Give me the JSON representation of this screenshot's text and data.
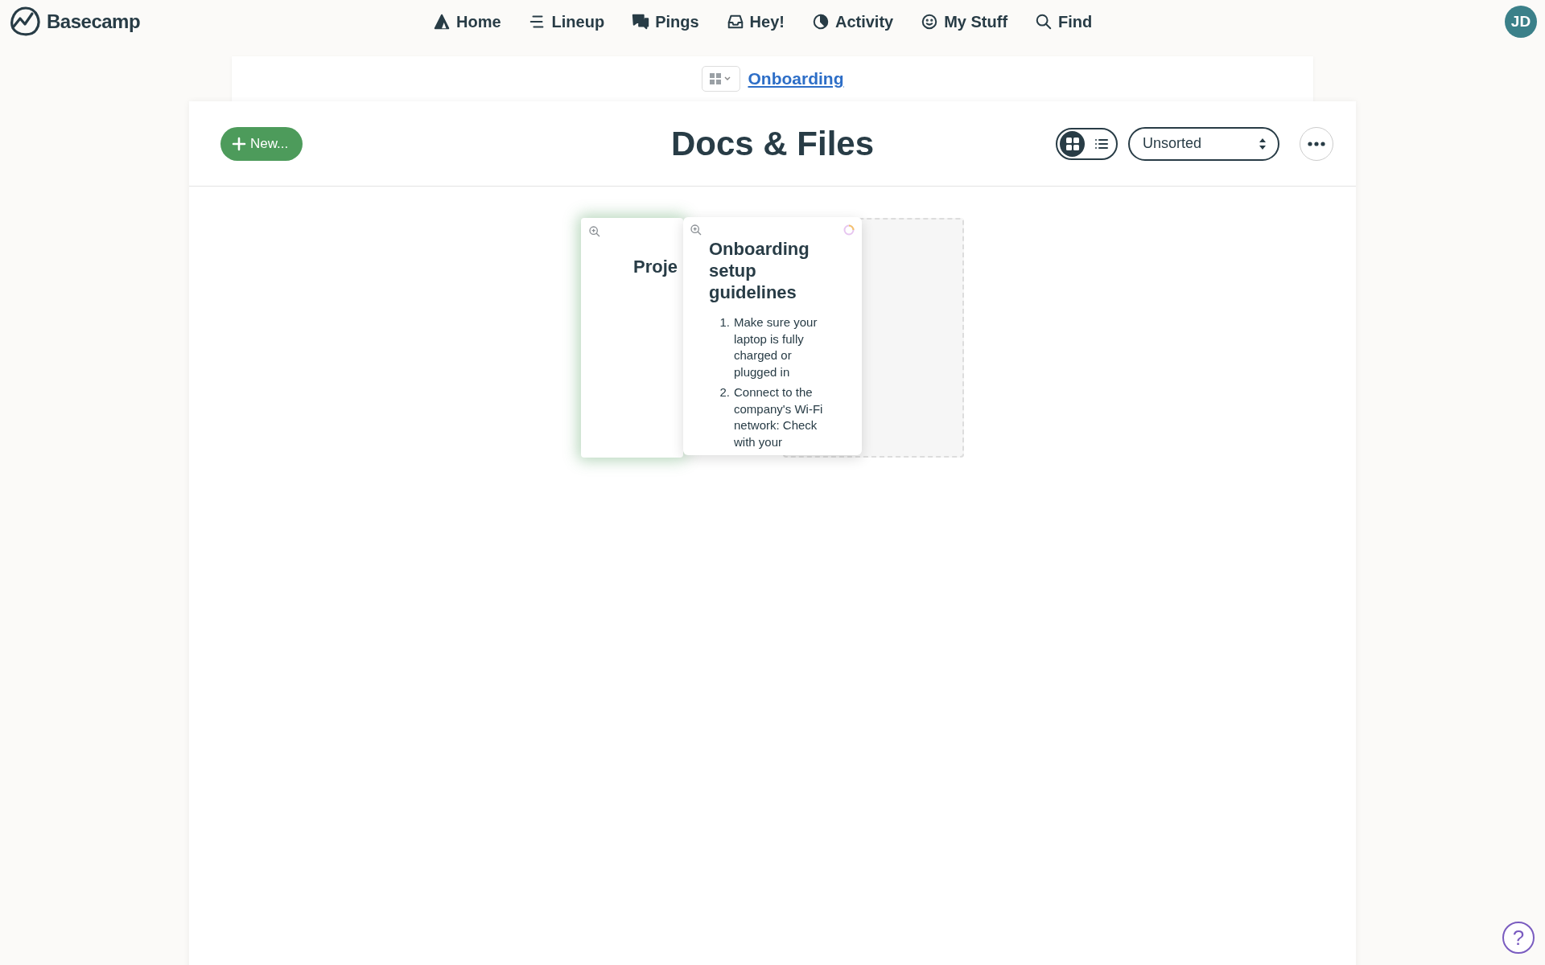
{
  "app": {
    "name": "Basecamp"
  },
  "nav": [
    {
      "label": "Home"
    },
    {
      "label": "Lineup"
    },
    {
      "label": "Pings"
    },
    {
      "label": "Hey!"
    },
    {
      "label": "Activity"
    },
    {
      "label": "My Stuff"
    },
    {
      "label": "Find"
    }
  ],
  "avatar": {
    "initials": "JD"
  },
  "breadcrumb": {
    "project": "Onboarding"
  },
  "toolbar": {
    "new_button": "New...",
    "title": "Docs & Files",
    "views": [
      {
        "kind": "grid",
        "selected": true
      },
      {
        "kind": "list",
        "selected": false
      }
    ],
    "sort": "Unsorted"
  },
  "cards": [
    {
      "title": "Proje",
      "drop_target": true
    }
  ],
  "dragged_card": {
    "title": "Onboarding setup guidelines",
    "steps": [
      {
        "marker": "1.",
        "text": "Make sure your laptop is fully charged or plugged in"
      },
      {
        "marker": "2.",
        "text": "Connect to the company's Wi-Fi network: Check with your"
      }
    ]
  },
  "help": {
    "label": "?"
  }
}
